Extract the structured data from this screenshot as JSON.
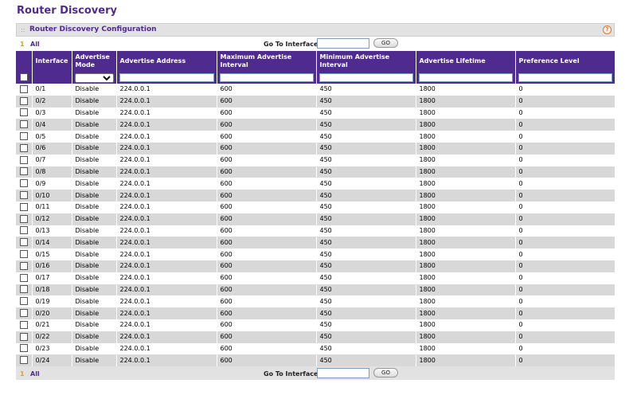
{
  "page": {
    "title": "Router Discovery"
  },
  "panel": {
    "title": "Router Discovery Configuration",
    "help_icon": "?",
    "collapse_icon": "::"
  },
  "nav": {
    "page_number": "1",
    "all_label": "All",
    "goto_label": "Go To Interface",
    "go_label": "GO",
    "goto_value": ""
  },
  "columns": {
    "interface": "Interface",
    "advertise_mode": "Advertise Mode",
    "advertise_address": "Advertise Address",
    "max_interval": "Maximum Advertise Interval",
    "min_interval": "Minimum Advertise Interval",
    "advertise_lifetime": "Advertise Lifetime",
    "preference_level": "Preference Level"
  },
  "rows": [
    {
      "interface": "0/1",
      "mode": "Disable",
      "address": "224.0.0.1",
      "max": "600",
      "min": "450",
      "lifetime": "1800",
      "pref": "0"
    },
    {
      "interface": "0/2",
      "mode": "Disable",
      "address": "224.0.0.1",
      "max": "600",
      "min": "450",
      "lifetime": "1800",
      "pref": "0"
    },
    {
      "interface": "0/3",
      "mode": "Disable",
      "address": "224.0.0.1",
      "max": "600",
      "min": "450",
      "lifetime": "1800",
      "pref": "0"
    },
    {
      "interface": "0/4",
      "mode": "Disable",
      "address": "224.0.0.1",
      "max": "600",
      "min": "450",
      "lifetime": "1800",
      "pref": "0"
    },
    {
      "interface": "0/5",
      "mode": "Disable",
      "address": "224.0.0.1",
      "max": "600",
      "min": "450",
      "lifetime": "1800",
      "pref": "0"
    },
    {
      "interface": "0/6",
      "mode": "Disable",
      "address": "224.0.0.1",
      "max": "600",
      "min": "450",
      "lifetime": "1800",
      "pref": "0"
    },
    {
      "interface": "0/7",
      "mode": "Disable",
      "address": "224.0.0.1",
      "max": "600",
      "min": "450",
      "lifetime": "1800",
      "pref": "0"
    },
    {
      "interface": "0/8",
      "mode": "Disable",
      "address": "224.0.0.1",
      "max": "600",
      "min": "450",
      "lifetime": "1800",
      "pref": "0"
    },
    {
      "interface": "0/9",
      "mode": "Disable",
      "address": "224.0.0.1",
      "max": "600",
      "min": "450",
      "lifetime": "1800",
      "pref": "0"
    },
    {
      "interface": "0/10",
      "mode": "Disable",
      "address": "224.0.0.1",
      "max": "600",
      "min": "450",
      "lifetime": "1800",
      "pref": "0"
    },
    {
      "interface": "0/11",
      "mode": "Disable",
      "address": "224.0.0.1",
      "max": "600",
      "min": "450",
      "lifetime": "1800",
      "pref": "0"
    },
    {
      "interface": "0/12",
      "mode": "Disable",
      "address": "224.0.0.1",
      "max": "600",
      "min": "450",
      "lifetime": "1800",
      "pref": "0"
    },
    {
      "interface": "0/13",
      "mode": "Disable",
      "address": "224.0.0.1",
      "max": "600",
      "min": "450",
      "lifetime": "1800",
      "pref": "0"
    },
    {
      "interface": "0/14",
      "mode": "Disable",
      "address": "224.0.0.1",
      "max": "600",
      "min": "450",
      "lifetime": "1800",
      "pref": "0"
    },
    {
      "interface": "0/15",
      "mode": "Disable",
      "address": "224.0.0.1",
      "max": "600",
      "min": "450",
      "lifetime": "1800",
      "pref": "0"
    },
    {
      "interface": "0/16",
      "mode": "Disable",
      "address": "224.0.0.1",
      "max": "600",
      "min": "450",
      "lifetime": "1800",
      "pref": "0"
    },
    {
      "interface": "0/17",
      "mode": "Disable",
      "address": "224.0.0.1",
      "max": "600",
      "min": "450",
      "lifetime": "1800",
      "pref": "0"
    },
    {
      "interface": "0/18",
      "mode": "Disable",
      "address": "224.0.0.1",
      "max": "600",
      "min": "450",
      "lifetime": "1800",
      "pref": "0"
    },
    {
      "interface": "0/19",
      "mode": "Disable",
      "address": "224.0.0.1",
      "max": "600",
      "min": "450",
      "lifetime": "1800",
      "pref": "0"
    },
    {
      "interface": "0/20",
      "mode": "Disable",
      "address": "224.0.0.1",
      "max": "600",
      "min": "450",
      "lifetime": "1800",
      "pref": "0"
    },
    {
      "interface": "0/21",
      "mode": "Disable",
      "address": "224.0.0.1",
      "max": "600",
      "min": "450",
      "lifetime": "1800",
      "pref": "0"
    },
    {
      "interface": "0/22",
      "mode": "Disable",
      "address": "224.0.0.1",
      "max": "600",
      "min": "450",
      "lifetime": "1800",
      "pref": "0"
    },
    {
      "interface": "0/23",
      "mode": "Disable",
      "address": "224.0.0.1",
      "max": "600",
      "min": "450",
      "lifetime": "1800",
      "pref": "0"
    },
    {
      "interface": "0/24",
      "mode": "Disable",
      "address": "224.0.0.1",
      "max": "600",
      "min": "450",
      "lifetime": "1800",
      "pref": "0"
    }
  ],
  "colors": {
    "accent": "#4f2b8f",
    "row_alt": "#d8d8d8",
    "header_bar": "#e2e2e2",
    "page_number": "#e89a2c"
  }
}
